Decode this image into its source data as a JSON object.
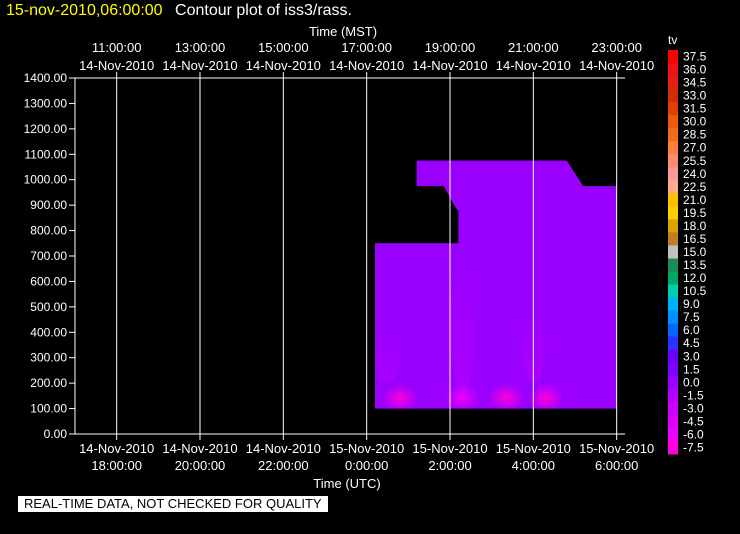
{
  "title": {
    "date": "15-nov-2010,06:00:00",
    "main": "Contour plot of iss3/rass."
  },
  "footer_note": "REAL-TIME DATA, NOT CHECKED FOR QUALITY",
  "colors": {
    "background": "#000000",
    "foreground": "#ffffff",
    "title_date": "#ffff00",
    "data_fill": "#9900ff"
  },
  "chart_data": {
    "type": "heatmap",
    "variable": "tv",
    "x_top_label": "Time (MST)",
    "x_bottom_label": "Time (UTC)",
    "ylim": [
      0,
      1400
    ],
    "y_ticks": [
      "0.00",
      "100.00",
      "200.00",
      "300.00",
      "400.00",
      "500.00",
      "600.00",
      "700.00",
      "800.00",
      "900.00",
      "1000.00",
      "1100.00",
      "1200.00",
      "1300.00",
      "1400.00"
    ],
    "x_top_ticks": [
      {
        "time": "11:00:00",
        "date": "14-Nov-2010"
      },
      {
        "time": "13:00:00",
        "date": "14-Nov-2010"
      },
      {
        "time": "15:00:00",
        "date": "14-Nov-2010"
      },
      {
        "time": "17:00:00",
        "date": "14-Nov-2010"
      },
      {
        "time": "19:00:00",
        "date": "14-Nov-2010"
      },
      {
        "time": "21:00:00",
        "date": "14-Nov-2010"
      },
      {
        "time": "23:00:00",
        "date": "14-Nov-2010"
      }
    ],
    "x_bottom_ticks": [
      {
        "date": "14-Nov-2010",
        "time": "18:00:00"
      },
      {
        "date": "14-Nov-2010",
        "time": "20:00:00"
      },
      {
        "date": "14-Nov-2010",
        "time": "22:00:00"
      },
      {
        "date": "15-Nov-2010",
        "time": "0:00:00"
      },
      {
        "date": "15-Nov-2010",
        "time": "2:00:00"
      },
      {
        "date": "15-Nov-2010",
        "time": "4:00:00"
      },
      {
        "date": "15-Nov-2010",
        "time": "6:00:00"
      }
    ],
    "x_bottom_hours": [
      18,
      20,
      22,
      24,
      26,
      28,
      30
    ],
    "x_range_hours_utc": [
      17,
      30.2
    ],
    "data_region": {
      "outline_hours_heights": [
        [
          24.2,
          100
        ],
        [
          30,
          100
        ],
        [
          30,
          975
        ],
        [
          29.2,
          975
        ],
        [
          28.8,
          1075
        ],
        [
          25.2,
          1075
        ],
        [
          25.2,
          975
        ],
        [
          25.85,
          975
        ],
        [
          26.1,
          900
        ],
        [
          26.2,
          875
        ],
        [
          26.2,
          750
        ],
        [
          24.2,
          750
        ]
      ],
      "hot_spots": [
        {
          "hour": 24.8,
          "height": 150,
          "value": -7.5
        },
        {
          "hour": 26.3,
          "height": 150,
          "value": -6.0
        },
        {
          "hour": 27.35,
          "height": 150,
          "value": -7.5
        },
        {
          "hour": 28.3,
          "height": 150,
          "value": -7.5
        }
      ],
      "cool_streaks": [
        {
          "hour": 24.5,
          "low": 200,
          "high": 400,
          "value": -1.5
        },
        {
          "hour": 26.3,
          "low": 150,
          "high": 700,
          "value": -1.5
        },
        {
          "hour": 28.0,
          "low": 200,
          "high": 500,
          "value": -1.5
        }
      ]
    },
    "colorbar": {
      "label": "tv",
      "ticks": [
        "37.5",
        "36.0",
        "34.5",
        "33.0",
        "31.5",
        "30.0",
        "28.5",
        "27.0",
        "25.5",
        "24.0",
        "22.5",
        "21.0",
        "19.5",
        "18.0",
        "16.5",
        "15.0",
        "13.5",
        "12.0",
        "10.5",
        "9.0",
        "7.5",
        "6.0",
        "4.5",
        "3.0",
        "1.5",
        "0.0",
        "-1.5",
        "-3.0",
        "-4.5",
        "-6.0",
        "-7.5"
      ],
      "colors": [
        "#ff0000",
        "#f0101a",
        "#e12010",
        "#d02e00",
        "#e04000",
        "#ee5a08",
        "#f26a1a",
        "#ff7f3f",
        "#ff8c72",
        "#ff9a9a",
        "#ffaa88",
        "#ffbf00",
        "#ffd000",
        "#e0a000",
        "#c08020",
        "#c0c0c0",
        "#1a8a5a",
        "#00aa66",
        "#00d0aa",
        "#00b0ff",
        "#0090ff",
        "#0066ff",
        "#2a33ff",
        "#6a00ff",
        "#7f00ff",
        "#9900ff",
        "#b300ff",
        "#cc00ff",
        "#dd00ff",
        "#ee00ff",
        "#ff00dd"
      ]
    }
  }
}
